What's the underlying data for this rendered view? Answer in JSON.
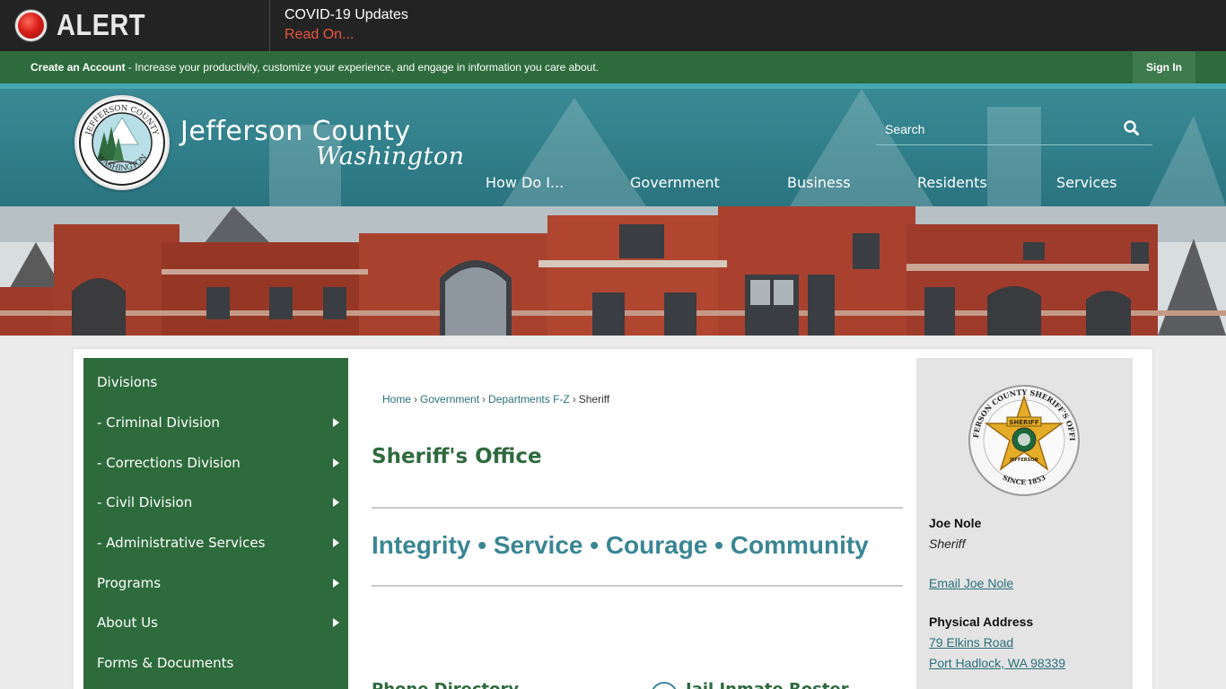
{
  "alert": {
    "label": "ALERT",
    "title": "COVID-19 Updates",
    "link": "Read On..."
  },
  "account_bar": {
    "create_link": "Create an Account",
    "message": " - Increase your productivity, customize your experience, and engage in information you care about.",
    "sign_in": "Sign In"
  },
  "header": {
    "title": "Jefferson County",
    "subtitle": "Washington",
    "seal_top": "JEFFERSON COUNTY",
    "seal_bottom": "WASHINGTON",
    "search_placeholder": "Search"
  },
  "nav": [
    {
      "label": "How Do I..."
    },
    {
      "label": "Government"
    },
    {
      "label": "Business"
    },
    {
      "label": "Residents"
    },
    {
      "label": "Services"
    }
  ],
  "sidebar": {
    "items": [
      {
        "label": "Divisions",
        "arrow": false
      },
      {
        "label": "- Criminal Division",
        "arrow": true
      },
      {
        "label": "- Corrections Division",
        "arrow": true
      },
      {
        "label": "- Civil Division",
        "arrow": true
      },
      {
        "label": "- Administrative Services",
        "arrow": true
      },
      {
        "label": "Programs",
        "arrow": true
      },
      {
        "label": "About Us",
        "arrow": true
      },
      {
        "label": "Forms & Documents",
        "arrow": false
      }
    ]
  },
  "breadcrumb": {
    "items": [
      "Home",
      "Government",
      "Departments F-Z"
    ],
    "current": "Sheriff",
    "separator": "›"
  },
  "main": {
    "title": "Sheriff's Office",
    "motto": "Integrity • Service • Courage • Community",
    "section_heading": "Phone Directory",
    "quick_link": "Jail Inmate Roster"
  },
  "contact": {
    "badge_top": "JEFFERSON COUNTY SHERIFF'S OFFICE",
    "badge_star_top": "SHERIFF",
    "badge_star_bottom": "JEFFERSON",
    "badge_bottom": "SINCE 1853",
    "name": "Joe Nole",
    "role": "Sheriff",
    "email": "Email Joe Nole",
    "address_label": "Physical Address",
    "address_line1": "79 Elkins Road",
    "address_line2": "Port Hadlock, WA 98339"
  },
  "colors": {
    "alert_bg": "#232323",
    "alert_link": "#e8553f",
    "green": "#2d6b3c",
    "teal": "#2f7d88",
    "title_green": "#2f6a3f",
    "motto_teal": "#3a8693",
    "link": "#2a6f7a"
  }
}
